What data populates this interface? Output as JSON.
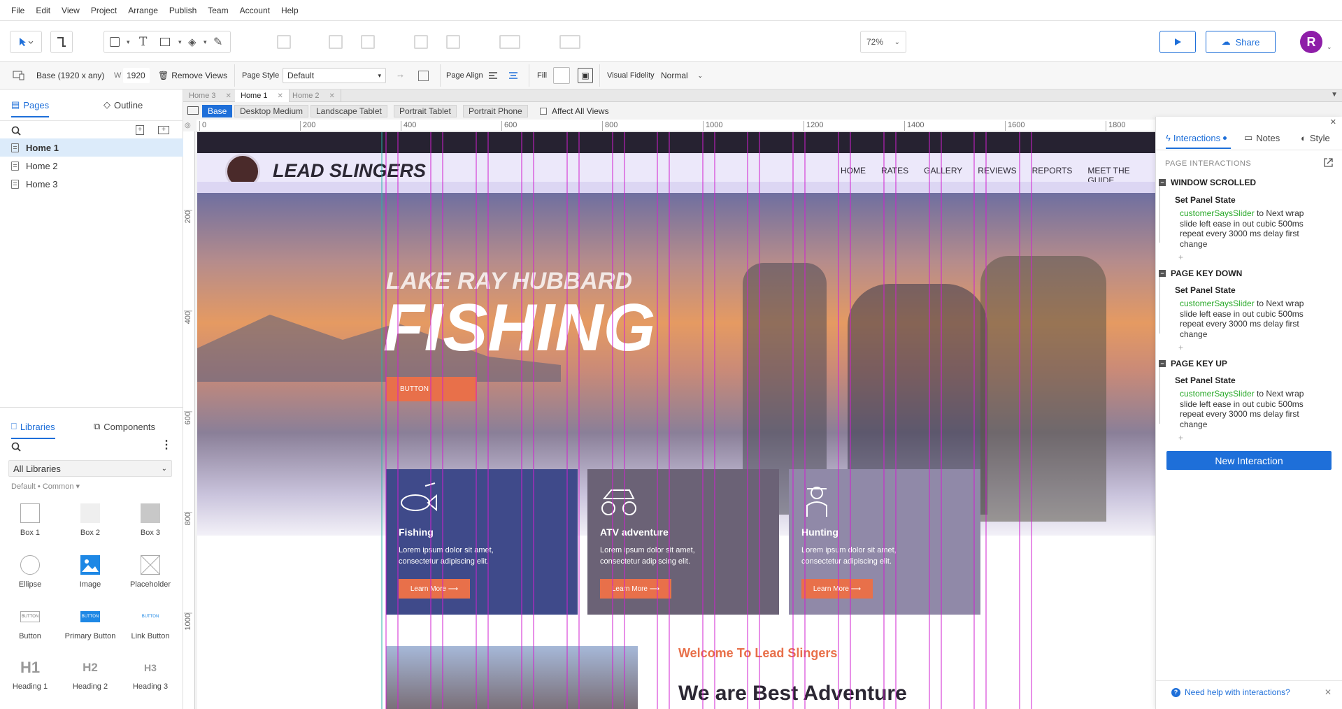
{
  "menu": [
    "File",
    "Edit",
    "View",
    "Project",
    "Arrange",
    "Publish",
    "Team",
    "Account",
    "Help"
  ],
  "toolbar": {
    "zoom": "72%",
    "share": "Share",
    "avatar": "R"
  },
  "propbar": {
    "view": "Base (1920 x any)",
    "w_label": "W",
    "w_value": "1920",
    "remove_views": "Remove Views",
    "page_style_label": "Page Style",
    "page_style_value": "Default",
    "page_align_label": "Page Align",
    "fill_label": "Fill",
    "fidelity_label": "Visual Fidelity",
    "fidelity_value": "Normal"
  },
  "left": {
    "tabs": {
      "pages": "Pages",
      "outline": "Outline"
    },
    "pages": [
      "Home 1",
      "Home 2",
      "Home 3"
    ],
    "lib_tabs": {
      "libraries": "Libraries",
      "components": "Components"
    },
    "library_select": "All Libraries",
    "library_path": "Default • Common ▾",
    "widgets": [
      "Box 1",
      "Box 2",
      "Box 3",
      "Ellipse",
      "Image",
      "Placeholder",
      "Button",
      "Primary Button",
      "Link Button",
      "Heading 1",
      "Heading 2",
      "Heading 3"
    ],
    "widget_preview": {
      "button": "BUTTON",
      "primary": "BUTTON",
      "link": "BUTTON",
      "h1": "H1",
      "h2": "H2",
      "h3": "H3"
    }
  },
  "doc_tabs": [
    "Home 3",
    "Home 1",
    "Home 2"
  ],
  "view_tabs": [
    "Base",
    "Desktop Medium",
    "Landscape Tablet",
    "Portrait Tablet",
    "Portrait Phone"
  ],
  "affect_all": "Affect All Views",
  "ruler": {
    "top": [
      "0",
      "200",
      "400",
      "600",
      "800",
      "1000",
      "1200",
      "1400",
      "1600",
      "1800"
    ],
    "left": [
      "200",
      "400",
      "600",
      "800",
      "1000"
    ]
  },
  "site": {
    "logo": "LEAD SLINGERS",
    "nav": [
      "HOME",
      "RATES",
      "GALLERY",
      "REVIEWS",
      "REPORTS",
      "MEET THE GUIDE"
    ],
    "hero_sub": "LAKE RAY HUBBARD",
    "hero_title": "FISHING",
    "hero_button": "BUTTON",
    "cards": [
      {
        "title": "Fishing",
        "text": "Lorem ipsum dolor sit amet, consectetur adipiscing elit.",
        "btn": "Learn More ⟶"
      },
      {
        "title": "ATV adventure",
        "text": "Lorem ipsum dolor sit amet, consectetur adipiscing elit.",
        "btn": "Learn More ⟶"
      },
      {
        "title": "Hunting",
        "text": "Lorem ipsum dolor sit amet, consectetur adipiscing elit.",
        "btn": "Learn More ⟶"
      }
    ],
    "welcome": "Welcome To Lead Slingers",
    "headline": "We are Best Adventure"
  },
  "right": {
    "tabs": {
      "interactions": "Interactions",
      "notes": "Notes",
      "style": "Style"
    },
    "section": "PAGE INTERACTIONS",
    "events": [
      {
        "name": "WINDOW SCROLLED",
        "action": "Set Panel State",
        "target": "customerSaysSlider",
        "desc": " to Next wrap slide left ease in out cubic 500ms repeat every 3000 ms delay first change"
      },
      {
        "name": "PAGE KEY DOWN",
        "action": "Set Panel State",
        "target": "customerSaysSlider",
        "desc": " to Next wrap slide left ease in out cubic 500ms repeat every 3000 ms delay first change"
      },
      {
        "name": "PAGE KEY UP",
        "action": "Set Panel State",
        "target": "customerSaysSlider",
        "desc": " to Next wrap slide left ease in out cubic 500ms repeat every 3000 ms delay first change"
      }
    ],
    "new_interaction": "New Interaction",
    "help": "Need help with interactions?"
  },
  "colors": {
    "accent": "#1e6fd9",
    "guide": "#d020d0",
    "orange": "#e8704a",
    "green": "#28a928"
  }
}
